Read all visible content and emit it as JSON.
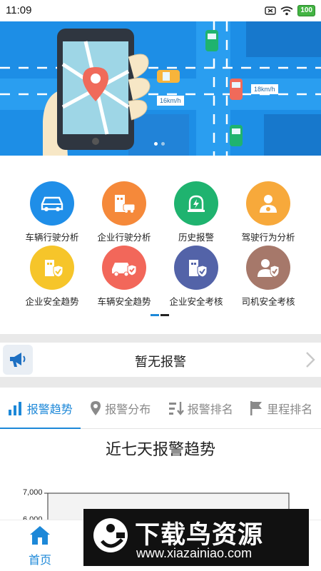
{
  "status_bar": {
    "time": "11:09",
    "battery": "100",
    "icons": [
      "sim-icon",
      "wifi-icon",
      "battery-icon"
    ]
  },
  "banner": {
    "speed_labels": [
      "16km/h",
      "18km/h"
    ],
    "slide_count": 2,
    "active_slide": 1
  },
  "features": [
    {
      "label": "车辆行驶分析",
      "icon": "car-icon",
      "color": "#1f8ee8"
    },
    {
      "label": "企业行驶分析",
      "icon": "company-car-icon",
      "color": "#f5893a"
    },
    {
      "label": "历史报警",
      "icon": "alarm-light-icon",
      "color": "#1fb36f"
    },
    {
      "label": "驾驶行为分析",
      "icon": "driver-icon",
      "color": "#f7a93b"
    },
    {
      "label": "企业安全趋势",
      "icon": "company-shield-icon",
      "color": "#f6c52a"
    },
    {
      "label": "车辆安全趋势",
      "icon": "car-shield-icon",
      "color": "#f2675a"
    },
    {
      "label": "企业安全考核",
      "icon": "company-check-icon",
      "color": "#5363a8"
    },
    {
      "label": "司机安全考核",
      "icon": "driver-check-icon",
      "color": "#a6786a"
    }
  ],
  "notice": {
    "text": "暂无报警",
    "icon": "megaphone-icon"
  },
  "tabs": [
    {
      "label": "报警趋势",
      "icon": "bar-chart-icon",
      "active": true
    },
    {
      "label": "报警分布",
      "icon": "location-pin-icon",
      "active": false
    },
    {
      "label": "报警排名",
      "icon": "sort-icon",
      "active": false
    },
    {
      "label": "里程排名",
      "icon": "flag-icon",
      "active": false
    }
  ],
  "chart": {
    "title": "近七天报警趋势",
    "y_ticks": [
      "7,000",
      "6,000"
    ]
  },
  "bottom_nav": {
    "home_label": "首页",
    "home_icon": "home-icon"
  },
  "watermark": {
    "title": "下载鸟资源",
    "url": "www.xiazainiao.com"
  },
  "colors": {
    "accent": "#1d88d8",
    "banner_blue": "#1d8ee6"
  }
}
